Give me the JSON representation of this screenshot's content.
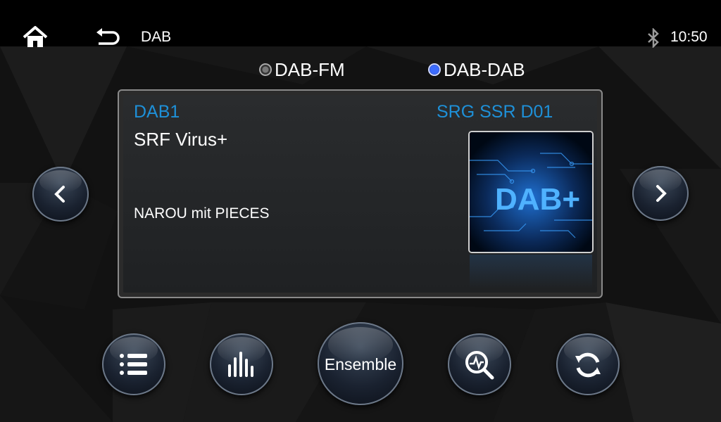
{
  "status_bar": {
    "title": "DAB",
    "time": "10:50",
    "icons": [
      "home-icon",
      "back-arrow-icon",
      "bluetooth-icon"
    ]
  },
  "mode": {
    "options": [
      {
        "label": "DAB-FM",
        "selected": false
      },
      {
        "label": "DAB-DAB",
        "selected": true
      }
    ]
  },
  "now_playing": {
    "band": "DAB1",
    "ensemble": "SRG SSR D01",
    "station": "SRF Virus+",
    "track_text": "NAROU mit PIECES",
    "slideshow_text": "DAB+"
  },
  "controls": {
    "ensemble_label": "Ensemble",
    "icons": [
      "chevron-left-icon",
      "chevron-right-icon",
      "list-icon",
      "equalizer-icon",
      "scan-icon",
      "refresh-icon"
    ]
  },
  "colors": {
    "accent_blue": "#1e90d8",
    "radio_selected": "#3c6cff",
    "background": "#0d0d0d"
  }
}
